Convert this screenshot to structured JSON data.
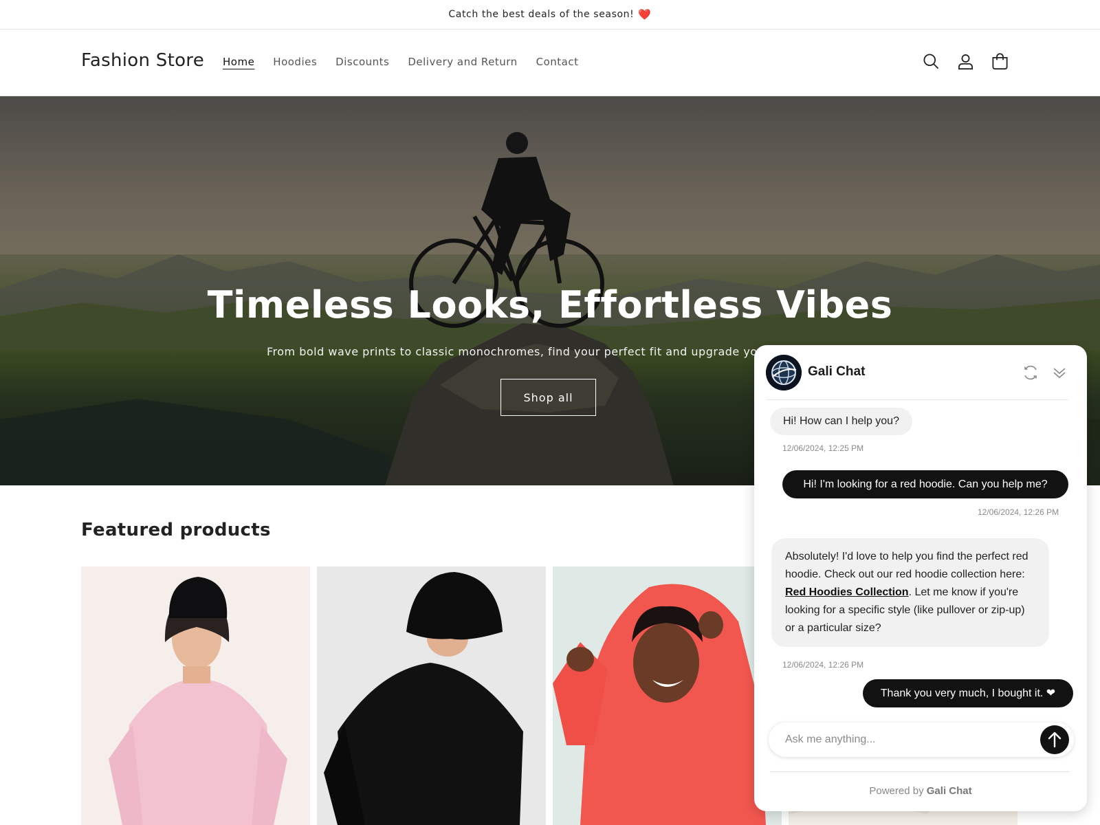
{
  "announcement": {
    "text": "Catch the best deals of the season!",
    "emoji": "❤️"
  },
  "header": {
    "logo": "Fashion Store",
    "nav": [
      "Home",
      "Hoodies",
      "Discounts",
      "Delivery and Return",
      "Contact"
    ],
    "active_nav": "Home",
    "icons": [
      "search-icon",
      "account-icon",
      "cart-icon"
    ]
  },
  "hero": {
    "title": "Timeless Looks, Effortless Vibes",
    "subtitle": "From bold wave prints to classic monochromes, find your perfect fit and upgrade your e",
    "button_label": "Shop all"
  },
  "featured": {
    "title": "Featured products",
    "products": [
      {
        "image": "pink-sweater-beanie"
      },
      {
        "image": "black-sweater-bucket-hat"
      },
      {
        "image": "red-hoodie"
      },
      {
        "image": "cream-sweater"
      }
    ]
  },
  "chat": {
    "title": "Gali Chat",
    "messages": [
      {
        "role": "bot",
        "text": "Hi! How can I help you?",
        "time": "12/06/2024, 12:25 PM"
      },
      {
        "role": "user",
        "text": "Hi! I'm looking for a red hoodie. Can you help me?",
        "time": "12/06/2024, 12:26 PM"
      },
      {
        "role": "bot",
        "text_before": "Absolutely! I'd love to help you find the perfect red hoodie. Check out our red hoodie collection here: ",
        "link": "Red Hoodies Collection",
        "text_after": ". Let me know if you're looking for a specific style (like pullover or zip-up) or a particular size?",
        "time": "12/06/2024, 12:26 PM"
      },
      {
        "role": "user",
        "text": "Thank you very much, I bought it. ❤"
      }
    ],
    "input_placeholder": "Ask me anything...",
    "powered_prefix": "Powered by",
    "powered_brand": "Gali Chat"
  },
  "colors": {
    "accent": "#121212",
    "bubble_bot": "#f1f1f1",
    "heart": "#e0242a"
  }
}
